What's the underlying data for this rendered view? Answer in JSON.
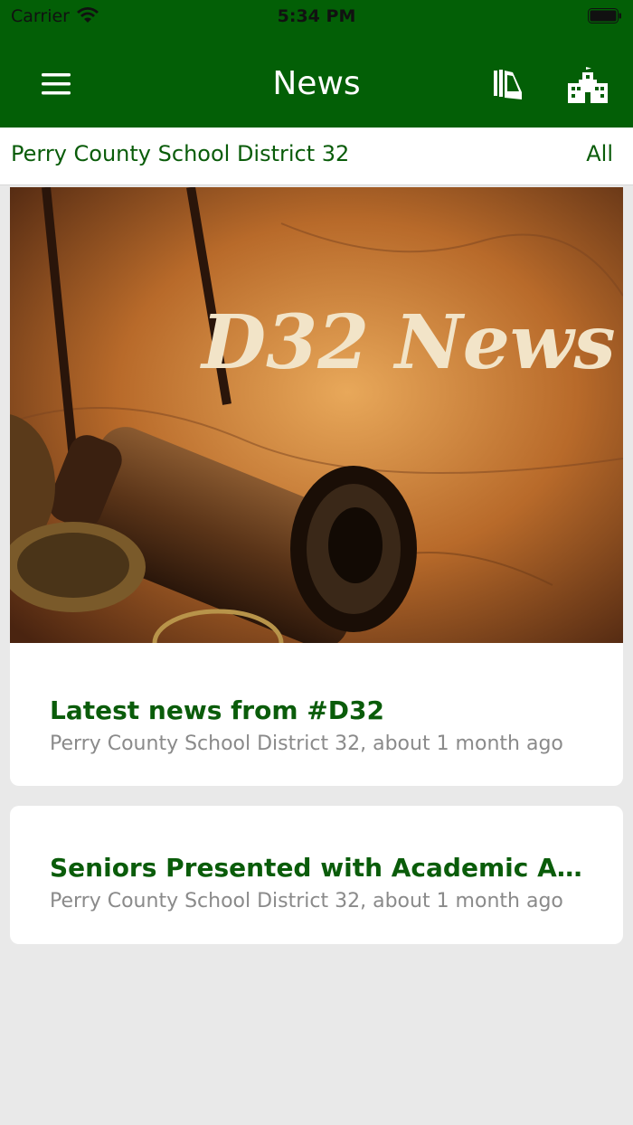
{
  "status_bar": {
    "carrier": "Carrier",
    "time": "5:34 PM"
  },
  "nav": {
    "title": "News",
    "menu_icon": "menu-icon",
    "books_icon": "books-icon",
    "school_icon": "school-icon"
  },
  "filter": {
    "district": "Perry County School District 32",
    "scope": "All"
  },
  "colors": {
    "brand_green": "#035f06",
    "title_green": "#0a5c0a",
    "meta_gray": "#8a8a8a",
    "background": "#e9e9e9"
  },
  "articles": [
    {
      "image_text": "D32 News",
      "title": "Latest news from #D32",
      "meta": "Perry County School District 32, about 1 month ago"
    },
    {
      "title": "Seniors Presented with Academic Awa...",
      "meta": "Perry County School District 32, about 1 month ago"
    }
  ]
}
